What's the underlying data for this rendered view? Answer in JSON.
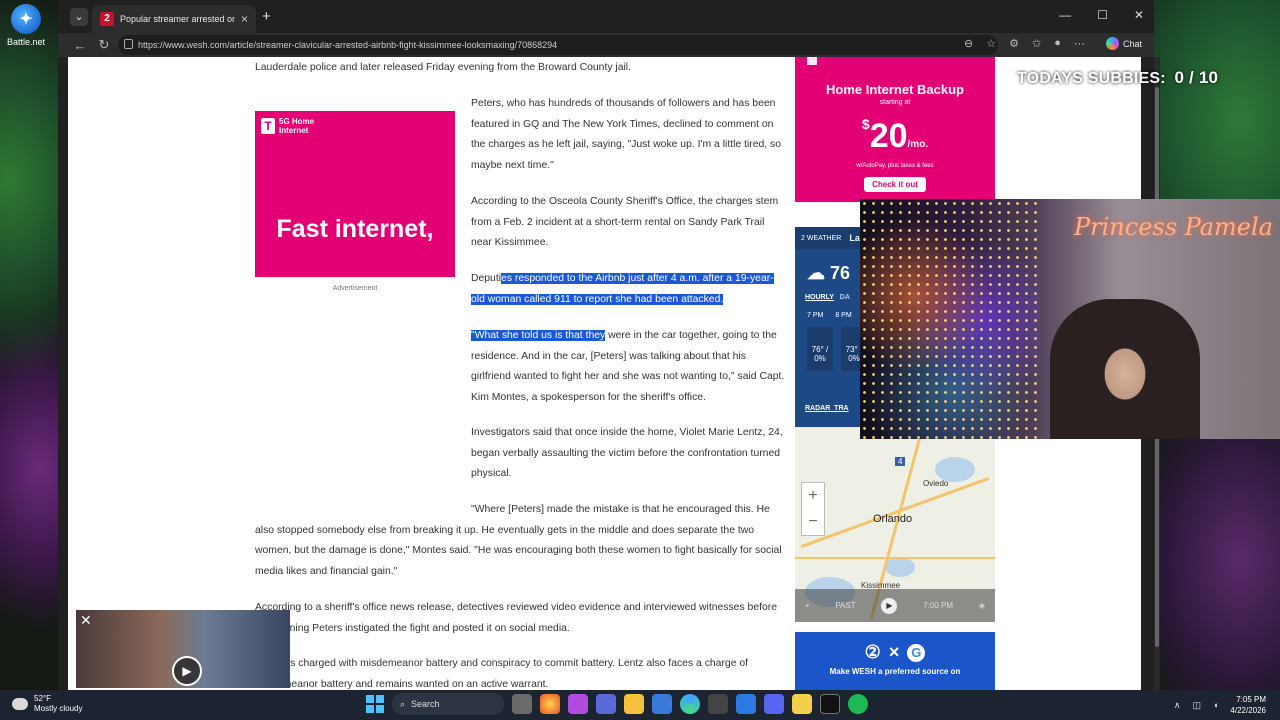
{
  "desktop": {
    "icon_label": "Battle.net"
  },
  "browser": {
    "tab_title": "Popular streamer arrested on battle",
    "url": "https://www.wesh.com/article/streamer-clavicular-arrested-airbnb-fight-kissimmee-looksmaxing/70868294",
    "chat_label": "Chat"
  },
  "article": {
    "p0": "Lauderdale police and later released Friday evening from the Broward County jail.",
    "p1": "Peters, who has hundreds of thousands of followers and has been featured in GQ and The New York Times, declined to comment on the charges as he left jail, saying, \"Just woke up. I'm a little tired, so maybe next time.\"",
    "p2": "According to the Osceola County Sheriff's Office, the charges stem from a Feb. 2 incident at a short-term rental on Sandy Park Trail near Kissimmee.",
    "p3_pre": "Deputi",
    "p3_hl": "es responded to the Airbnb just after 4 a.m. after a 19-year-old woman called 911 to report she had been attacked.",
    "p4_hl": "\"What she told us is that they",
    "p4_rest": " were in the car together, going to the residence. And in the car, [Peters] was talking about that his girlfriend wanted to fight her and she was not wanting to,\" said Capt. Kim Montes, a spokesperson for the sheriff's office.",
    "p5": "Investigators said that once inside the home, Violet Marie Lentz, 24, began verbally assaulting the victim before the confrontation turned physical.",
    "p6": "\"Where [Peters] made the mistake is that he encouraged this. He also stopped somebody else from breaking it up. He eventually gets in the middle and does separate the two women, but the damage is done,\" Montes said. \"He was encouraging both these women to fight basically for social media likes and financial gain.\"",
    "p7": "According to a sheriff's office news release, detectives reviewed video evidence and interviewed witnesses before determining Peters instigated the fight and posted it on social media.",
    "p8": "Peters is charged with misdemeanor battery and conspiracy to commit battery. Lentz also faces a charge of misdemeanor battery and remains wanted on an active warrant."
  },
  "ad_left": {
    "brand": "5G Home Internet",
    "headline": "Fast internet,",
    "label": "Advertisement"
  },
  "ad_right": {
    "title": "Home Internet Backup",
    "sub": "starting at",
    "price": "20",
    "currency": "$",
    "unit": "/mo.",
    "fine": "w/AutoPay, plus taxes & fees",
    "cta": "Check it out"
  },
  "weather": {
    "brand": "2 WEATHER",
    "loc": "Lat",
    "temp": "76",
    "hourly": "HOURLY",
    "daily": "DA",
    "hours": [
      "7 PM",
      "8 PM"
    ],
    "cells": [
      "76° / 0%",
      "73° / 0%"
    ],
    "radar": "RADAR",
    "traffic": "TRA"
  },
  "map": {
    "city": "Orlando",
    "oviedo": "Oviedo",
    "kissimmee": "Kissimmee",
    "hwy": "4",
    "past": "PAST",
    "time": "7:00 PM"
  },
  "wesh_ad": {
    "text": "Make WESH a preferred source on",
    "g": "G",
    "cross": "×"
  },
  "overlay": {
    "subs_label": "TODAYS SUBBIES:",
    "subs_value": "0 / 10",
    "streamer_name": "Princess Pamela"
  },
  "taskbar": {
    "temp": "52°F",
    "cond": "Mostly cloudy",
    "search": "Search",
    "time": "7:05 PM",
    "date": "4/22/2026"
  }
}
